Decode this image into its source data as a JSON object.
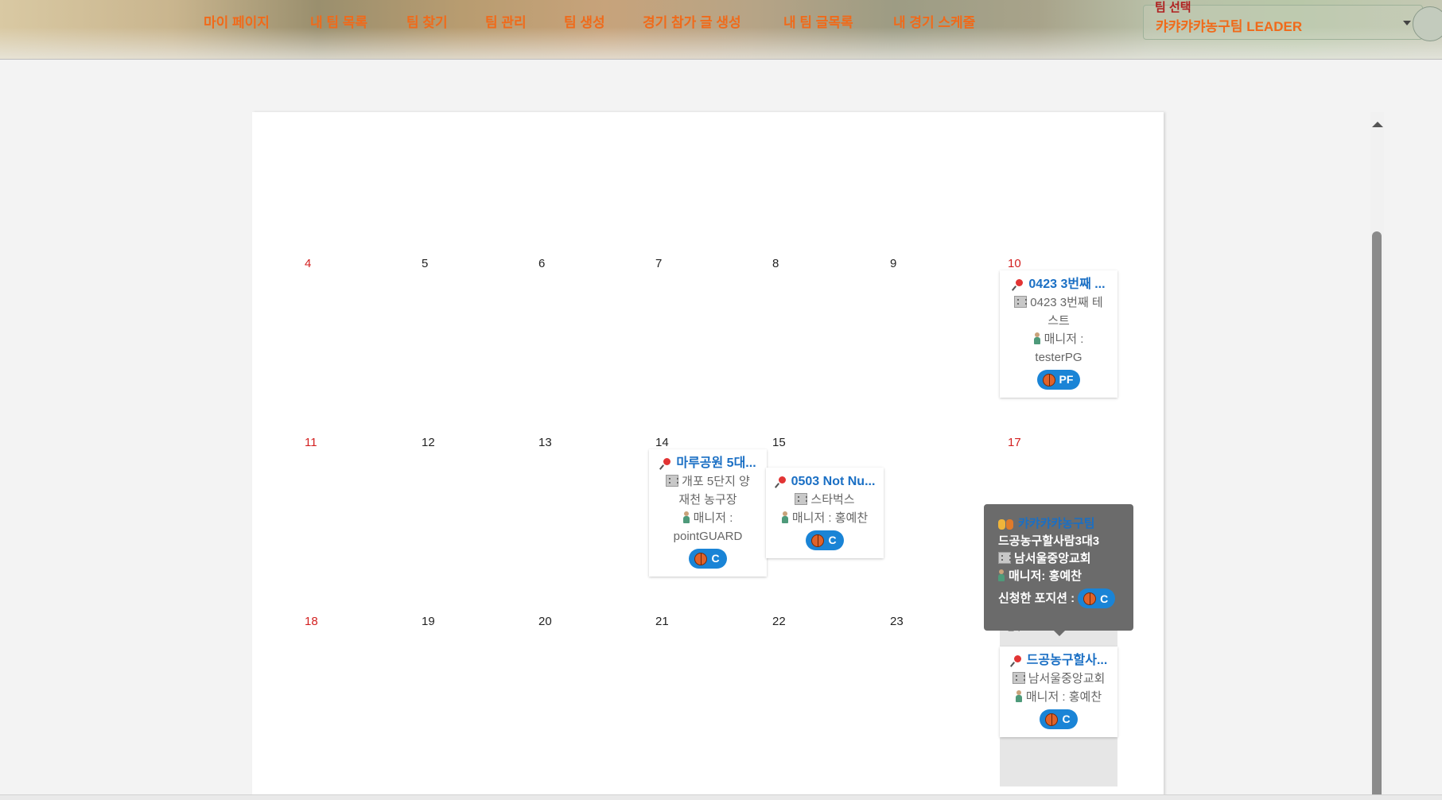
{
  "nav": {
    "items": [
      "마이 페이지",
      "내 팀 목록",
      "팀 찾기",
      "팀 관리",
      "팀 생성",
      "경기 참가 글 생성",
      "내 팀 글목록",
      "내 경기 스케줄"
    ]
  },
  "team_select": {
    "label": "팀 선택",
    "value": "캬캬캬캬농구팀 LEADER"
  },
  "calendar": {
    "days": [
      "4",
      "5",
      "6",
      "7",
      "8",
      "9",
      "10",
      "11",
      "12",
      "13",
      "14",
      "15",
      "17",
      "18",
      "19",
      "20",
      "21",
      "22",
      "23",
      "24"
    ],
    "events": [
      {
        "title": "0423 3번째 ...",
        "location_line1": "0423 3번째 테",
        "location_line2": "스트",
        "manager_line1": "매니저 :",
        "manager_line2": "testerPG",
        "position": "PF"
      },
      {
        "title": "마루공원 5대...",
        "location_line1": "개포 5단지 양",
        "location_line2": "재천 농구장",
        "manager_line1": "매니저 :",
        "manager_line2": "pointGUARD",
        "position": "C"
      },
      {
        "title": "0503 Not Nu...",
        "location_line1": "스타벅스",
        "manager_line1": "매니저 : 홍예찬",
        "position": "C"
      },
      {
        "title": "드공농구할사...",
        "location_line1": "남서울중앙교회",
        "manager_line1": "매니저 : 홍예찬",
        "position": "C"
      }
    ]
  },
  "tooltip": {
    "team": "캬캬캬캬농구팀",
    "title": "드공농구할사람3대3",
    "location": "남서울중앙교회",
    "manager": "매니저: 홍예찬",
    "position_label": "신청한 포지션 :",
    "position": "C"
  },
  "colors": {
    "nav_text": "#f06a1a",
    "sunday_red": "#d32020",
    "event_title_blue": "#1a6fc4",
    "chip_blue": "#1a84d6",
    "tooltip_bg": "#6b6b6b"
  },
  "icons": [
    "pin-icon",
    "building-icon",
    "person-icon",
    "basketball-icon",
    "people-icon",
    "dropdown-arrow-icon"
  ]
}
